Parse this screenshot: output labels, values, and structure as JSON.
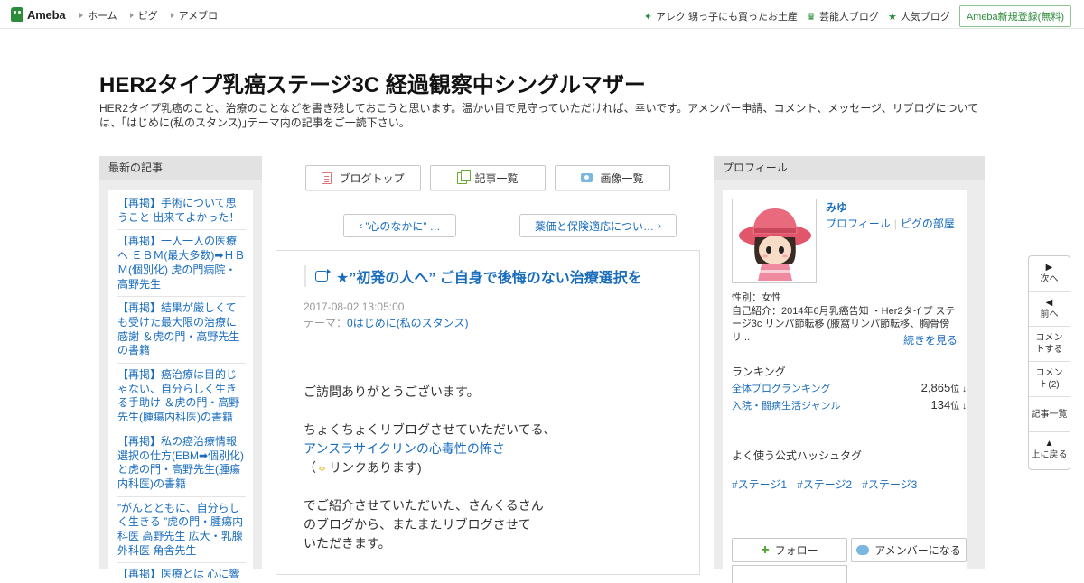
{
  "topbar": {
    "logo": "Ameba",
    "nav": [
      "ホーム",
      "ピグ",
      "アメブロ"
    ],
    "right": [
      "アレク 甥っ子にも買ったお土産",
      "芸能人ブログ",
      "人気ブログ"
    ],
    "register": "Ameba新規登録(無料)"
  },
  "blog": {
    "title": "HER2タイプ乳癌ステージ3C 経過観察中シングルマザー",
    "description": "HER2タイプ乳癌のこと、治療のことなどを書き残しておこうと思います。温かい目で見守っていただければ、幸いです。アメンバー申請、コメント、メッセージ、リブログについては、｢はじめに(私のスタンス)｣テーマ内の記事をご一読下さい。"
  },
  "left": {
    "heading": "最新の記事",
    "entries": [
      "【再掲】手術について思うこと 出来てよかった！",
      "【再掲】一人一人の医療へ ＥＢＭ(最大多数)➡ＨＢＭ(個別化) 虎の門病院・高野先生",
      "【再掲】結果が厳しくても受けた最大限の治療に感謝 ＆虎の門・高野先生の書籍",
      "【再掲】癌治療は目的じゃない、自分らしく生きる手助け ＆虎の門・高野先生(腫瘍内科医)の書籍",
      "【再掲】私の癌治療情報選択の仕方(EBM➡個別化)と虎の門・高野先生(腫瘍内科医)の書籍",
      "”がんとともに、自分らしく生きる ”虎の門・腫瘍内科医 高野先生 広大・乳腺外科医 角舎先生",
      "【再掲】医療とは 心に響く"
    ]
  },
  "center": {
    "buttons": {
      "top": "ブログトップ",
      "list": "記事一覧",
      "images": "画像一覧"
    },
    "pager": {
      "prev": "”心のなかに” …",
      "next": "薬価と保険適応につい…"
    },
    "article": {
      "title": "★”初発の人へ” ご自身で後悔のない治療選択を",
      "date": "2017-08-02 13:05:00",
      "theme_label": "テーマ：",
      "theme": "0はじめに(私のスタンス)",
      "line1": "ご訪問ありがとうございます。",
      "line2": "ちょくちょくリブログさせていただいてる、",
      "link": "アンスラサイクリンの心毒性の怖さ",
      "line3a": "（",
      "line3b": "リンクあります)",
      "line4": "でご紹介させていただいた、さんくるさん",
      "line5": "のブログから、またまたリブログさせて",
      "line6": "いただきます。"
    }
  },
  "right": {
    "heading": "プロフィール",
    "name": "みゆ",
    "link_profile": "プロフィール",
    "link_room": "ピグの部屋",
    "gender": "性別：女性",
    "intro": "自己紹介：2014年6月乳癌告知 ・Her2タイプ ステージ3c リンパ節転移 (腋窩リンパ節転移、胸骨傍リ...",
    "more": "続きを見る",
    "ranking_head": "ランキング",
    "rank1_label": "全体ブログランキング",
    "rank1_value": "2,865",
    "rank2_label": "入院・闘病生活ジャンル",
    "rank2_value": "134",
    "rank_unit": "位 ↓",
    "tag_head": "よく使う公式ハッシュタグ",
    "tags": [
      "#ステージ1",
      "#ステージ2",
      "#ステージ3"
    ],
    "follow": "フォロー",
    "amember": "アメンバーになる"
  },
  "floatnav": {
    "next": "次へ",
    "prev": "前へ",
    "comment": "コメントする",
    "comments": "コメント(2)",
    "list": "記事一覧",
    "top": "上に戻る"
  },
  "colors": {
    "link": "#1a6dbd",
    "brand": "#2d8c3c"
  }
}
